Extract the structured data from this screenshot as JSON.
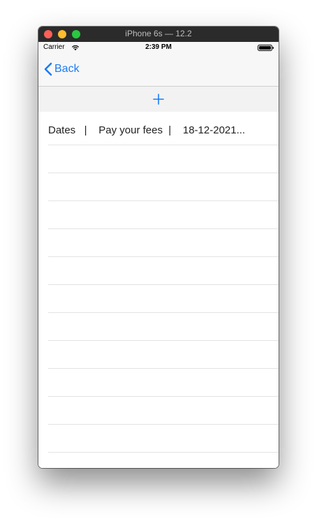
{
  "window": {
    "title": "iPhone 6s — 12.2"
  },
  "status_bar": {
    "carrier": "Carrier",
    "time": "2:39 PM"
  },
  "nav_bar": {
    "back_label": "Back"
  },
  "table": {
    "rows": [
      {
        "text": "Dates   |    Pay your fees  |    18-12-2021..."
      },
      {
        "text": ""
      },
      {
        "text": ""
      },
      {
        "text": ""
      },
      {
        "text": ""
      },
      {
        "text": ""
      },
      {
        "text": ""
      },
      {
        "text": ""
      },
      {
        "text": ""
      },
      {
        "text": ""
      },
      {
        "text": ""
      },
      {
        "text": ""
      }
    ]
  },
  "colors": {
    "tint": "#1a7cf5",
    "nav_background": "#f7f7f7",
    "add_bar_background": "#f2f2f2",
    "separator": "#e3e3e3"
  },
  "icons": {
    "back": "chevron-left-icon",
    "add": "plus-icon",
    "wifi": "wifi-icon",
    "battery": "battery-icon"
  }
}
